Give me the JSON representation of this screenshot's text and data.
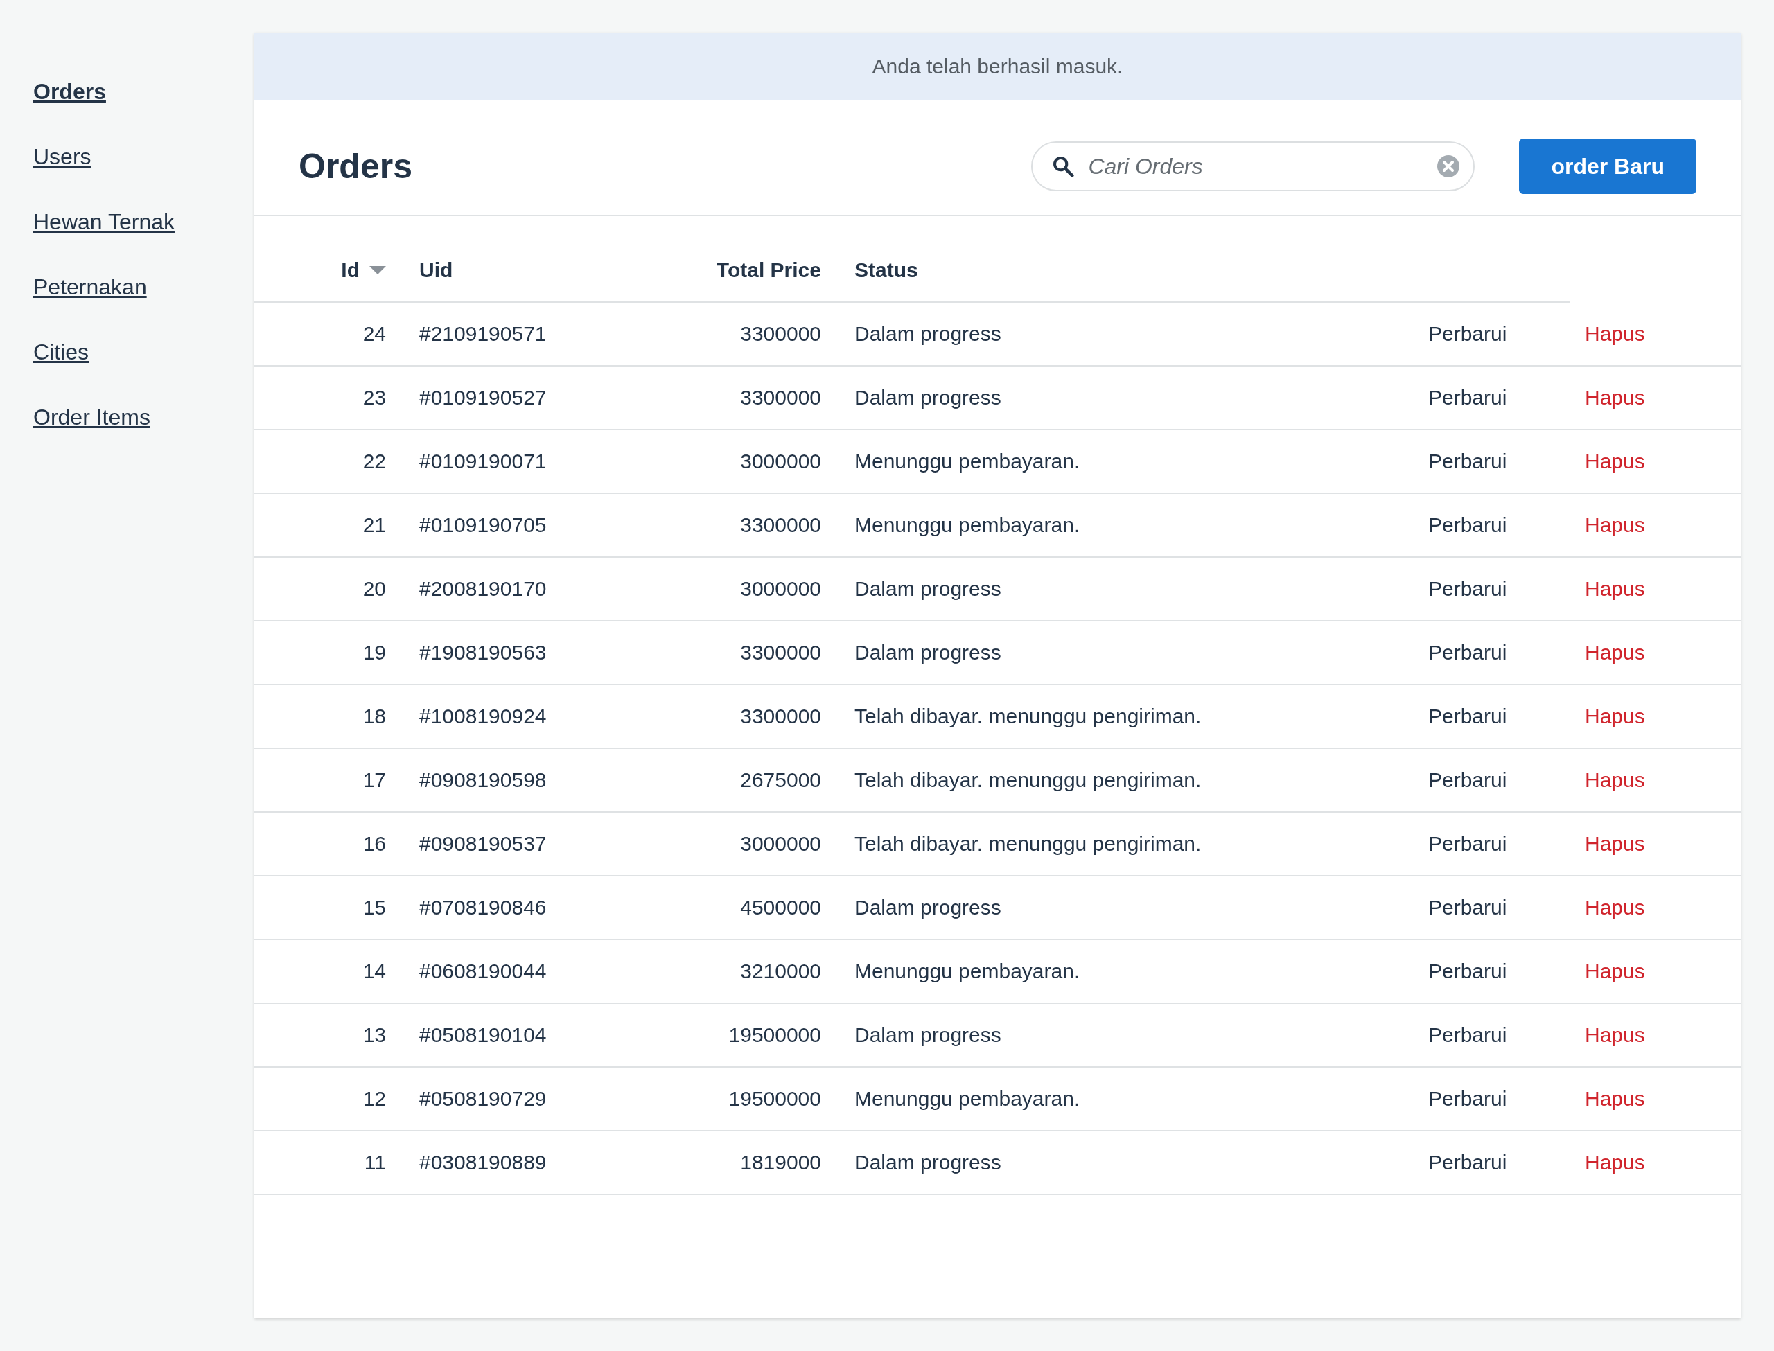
{
  "sidebar": {
    "items": [
      {
        "label": "Orders",
        "selected": true
      },
      {
        "label": "Users",
        "selected": false
      },
      {
        "label": "Hewan Ternak",
        "selected": false
      },
      {
        "label": "Peternakan",
        "selected": false
      },
      {
        "label": "Cities",
        "selected": false
      },
      {
        "label": "Order Items",
        "selected": false
      }
    ]
  },
  "flash": "Anda telah berhasil masuk.",
  "header": {
    "title": "Orders",
    "search": {
      "placeholder": "Cari Orders"
    },
    "button": "order Baru"
  },
  "table": {
    "columns": [
      {
        "label": "Id",
        "sorted": true
      },
      {
        "label": "Uid",
        "sorted": false
      },
      {
        "label": "Total Price",
        "sorted": false
      },
      {
        "label": "Status",
        "sorted": false
      }
    ],
    "rows": [
      {
        "id": "24",
        "uid": "#2109190571",
        "total_price": "3300000",
        "status": "Dalam progress",
        "edit": "Perbarui",
        "delete": "Hapus"
      },
      {
        "id": "23",
        "uid": "#0109190527",
        "total_price": "3300000",
        "status": "Dalam progress",
        "edit": "Perbarui",
        "delete": "Hapus"
      },
      {
        "id": "22",
        "uid": "#0109190071",
        "total_price": "3000000",
        "status": "Menunggu pembayaran.",
        "edit": "Perbarui",
        "delete": "Hapus"
      },
      {
        "id": "21",
        "uid": "#0109190705",
        "total_price": "3300000",
        "status": "Menunggu pembayaran.",
        "edit": "Perbarui",
        "delete": "Hapus"
      },
      {
        "id": "20",
        "uid": "#2008190170",
        "total_price": "3000000",
        "status": "Dalam progress",
        "edit": "Perbarui",
        "delete": "Hapus"
      },
      {
        "id": "19",
        "uid": "#1908190563",
        "total_price": "3300000",
        "status": "Dalam progress",
        "edit": "Perbarui",
        "delete": "Hapus"
      },
      {
        "id": "18",
        "uid": "#1008190924",
        "total_price": "3300000",
        "status": "Telah dibayar. menunggu pengiriman.",
        "edit": "Perbarui",
        "delete": "Hapus"
      },
      {
        "id": "17",
        "uid": "#0908190598",
        "total_price": "2675000",
        "status": "Telah dibayar. menunggu pengiriman.",
        "edit": "Perbarui",
        "delete": "Hapus"
      },
      {
        "id": "16",
        "uid": "#0908190537",
        "total_price": "3000000",
        "status": "Telah dibayar. menunggu pengiriman.",
        "edit": "Perbarui",
        "delete": "Hapus"
      },
      {
        "id": "15",
        "uid": "#0708190846",
        "total_price": "4500000",
        "status": "Dalam progress",
        "edit": "Perbarui",
        "delete": "Hapus"
      },
      {
        "id": "14",
        "uid": "#0608190044",
        "total_price": "3210000",
        "status": "Menunggu pembayaran.",
        "edit": "Perbarui",
        "delete": "Hapus"
      },
      {
        "id": "13",
        "uid": "#0508190104",
        "total_price": "19500000",
        "status": "Dalam progress",
        "edit": "Perbarui",
        "delete": "Hapus"
      },
      {
        "id": "12",
        "uid": "#0508190729",
        "total_price": "19500000",
        "status": "Menunggu pembayaran.",
        "edit": "Perbarui",
        "delete": "Hapus"
      },
      {
        "id": "11",
        "uid": "#0308190889",
        "total_price": "1819000",
        "status": "Dalam progress",
        "edit": "Perbarui",
        "delete": "Hapus"
      }
    ]
  }
}
